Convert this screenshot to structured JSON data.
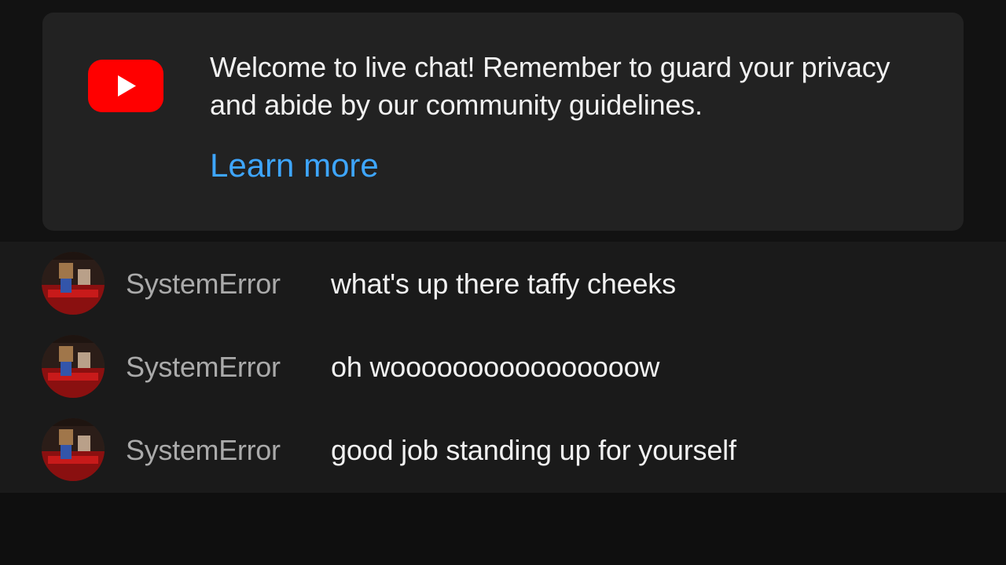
{
  "welcome": {
    "logo_icon": "youtube-play-icon",
    "brand_color": "#ff0000",
    "text": "Welcome to live chat! Remember to guard your privacy and abide by our community guidelines.",
    "link_label": "Learn more",
    "link_color": "#3ea6ff"
  },
  "messages": [
    {
      "author": "SystemError",
      "text": "what's up there taffy cheeks"
    },
    {
      "author": "SystemError",
      "text": "oh woooooooooooooooow"
    },
    {
      "author": "SystemError",
      "text": "good job standing up for yourself"
    }
  ]
}
